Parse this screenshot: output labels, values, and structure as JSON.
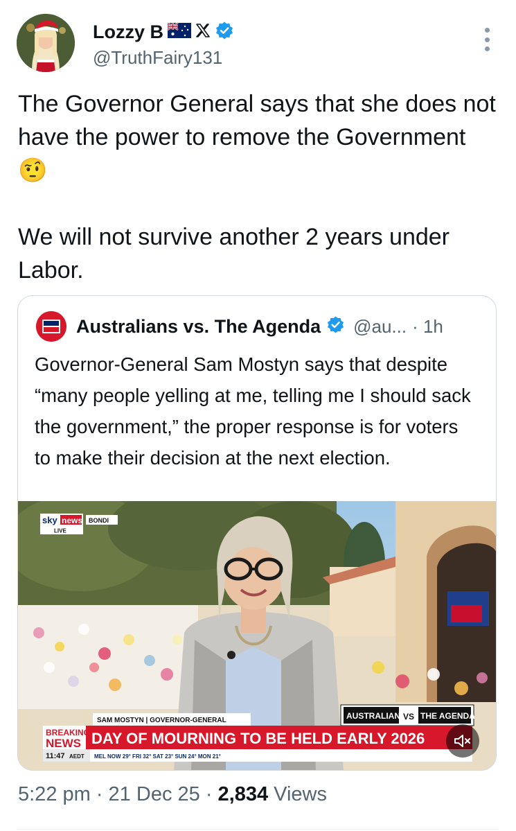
{
  "author": {
    "display_name": "Lozzy B",
    "handle": "@TruthFairy131",
    "flag_icon": "australian-flag-icon",
    "x_icon": "x-logo-icon",
    "verified_icon": "verified-badge-icon",
    "verified_color": "#1d9bf0"
  },
  "tweet": {
    "text": "The Governor General says that she does not have the power to remove the Government 🤨\n\nWe will not survive another 2 years under Labor.",
    "timestamp": "5:22 pm · 21 Dec 25 · ",
    "views_count": "2,834",
    "views_label": " Views"
  },
  "quote": {
    "display_name": "Australians vs. The Agenda",
    "handle": "@au...",
    "time": "· 1h",
    "text": "Governor-General Sam Mostyn says that despite “many people yelling at me, telling me I should sack the government,” the proper response is for voters to make their decision at the next election."
  },
  "media": {
    "channel_logo_sky": "sky",
    "channel_logo_news": "news",
    "live_label": "LIVE",
    "location": "BONDI",
    "name_strap": "SAM MOSTYN | GOVERNOR-GENERAL",
    "brand_left": "AUSTRALIANS",
    "brand_vs": "VS",
    "brand_right": "THE AGENDA",
    "breaking_1": "BREAKING",
    "breaking_2": "NEWS",
    "headline": "DAY OF MOURNING TO BE HELD EARLY 2026",
    "clock": "11:47",
    "clock_zone": "AEDT",
    "weather": "MEL NOW 29° FRI 32° SAT 23° SUN 24° MON 21°",
    "mute_icon": "speaker-muted-icon",
    "accent_red": "#d7182a"
  }
}
